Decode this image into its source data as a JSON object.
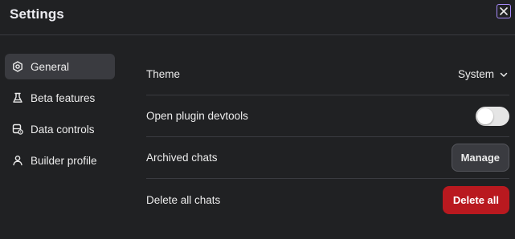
{
  "header": {
    "title": "Settings",
    "close_icon": "close-icon"
  },
  "sidebar": {
    "items": [
      {
        "label": "General",
        "icon": "gear-icon",
        "active": true
      },
      {
        "label": "Beta features",
        "icon": "flask-icon",
        "active": false
      },
      {
        "label": "Data controls",
        "icon": "database-icon",
        "active": false
      },
      {
        "label": "Builder profile",
        "icon": "user-icon",
        "active": false
      }
    ]
  },
  "settings": {
    "theme": {
      "label": "Theme",
      "value": "System"
    },
    "devtools": {
      "label": "Open plugin devtools",
      "enabled": false
    },
    "archived": {
      "label": "Archived chats",
      "button": "Manage"
    },
    "delete_all": {
      "label": "Delete all chats",
      "button": "Delete all"
    }
  },
  "colors": {
    "background": "#202123",
    "active_item": "#3a3b40",
    "danger": "#b9191f",
    "close_border": "#a78bfa"
  }
}
